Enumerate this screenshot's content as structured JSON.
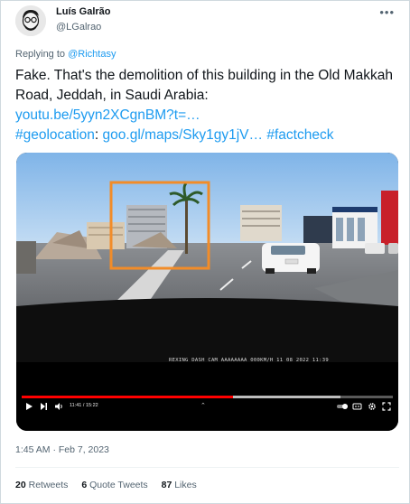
{
  "author": {
    "name": "Luís Galrão",
    "handle": "@LGalrao"
  },
  "reply": {
    "prefix": "Replying to",
    "mention": "@Richtasy"
  },
  "tweet": {
    "text": "Fake. That's the demolition of this building in the Old Makkah Road, Jeddah, in Saudi Arabia:",
    "link1": "youtu.be/5yyn2XCgnBM?t=…",
    "link2": "#geolocation",
    "sep": ": ",
    "link3": "goo.gl/maps/Sky1gy1jV…",
    "link4": "#factcheck"
  },
  "video": {
    "overlay_text": "REXING DASH CAM AAAAAAAA 000KM/H 11 08 2022 11:39",
    "time_display": "11:41 / 15:22",
    "progress": 0.57,
    "buffered": 0.86,
    "highlight_color": "#f28c28",
    "progress_color": "#ff0000"
  },
  "timestamp": "1:45 AM · Feb 7, 2023",
  "stats": {
    "retweets": {
      "count": "20",
      "label": "Retweets"
    },
    "quotes": {
      "count": "6",
      "label": "Quote Tweets"
    },
    "likes": {
      "count": "87",
      "label": "Likes"
    }
  },
  "icons": [
    "more-icon",
    "play-icon",
    "next-icon",
    "volume-icon",
    "chevron-up-icon",
    "toggle-icon",
    "captions-icon",
    "settings-icon",
    "fullscreen-icon"
  ]
}
